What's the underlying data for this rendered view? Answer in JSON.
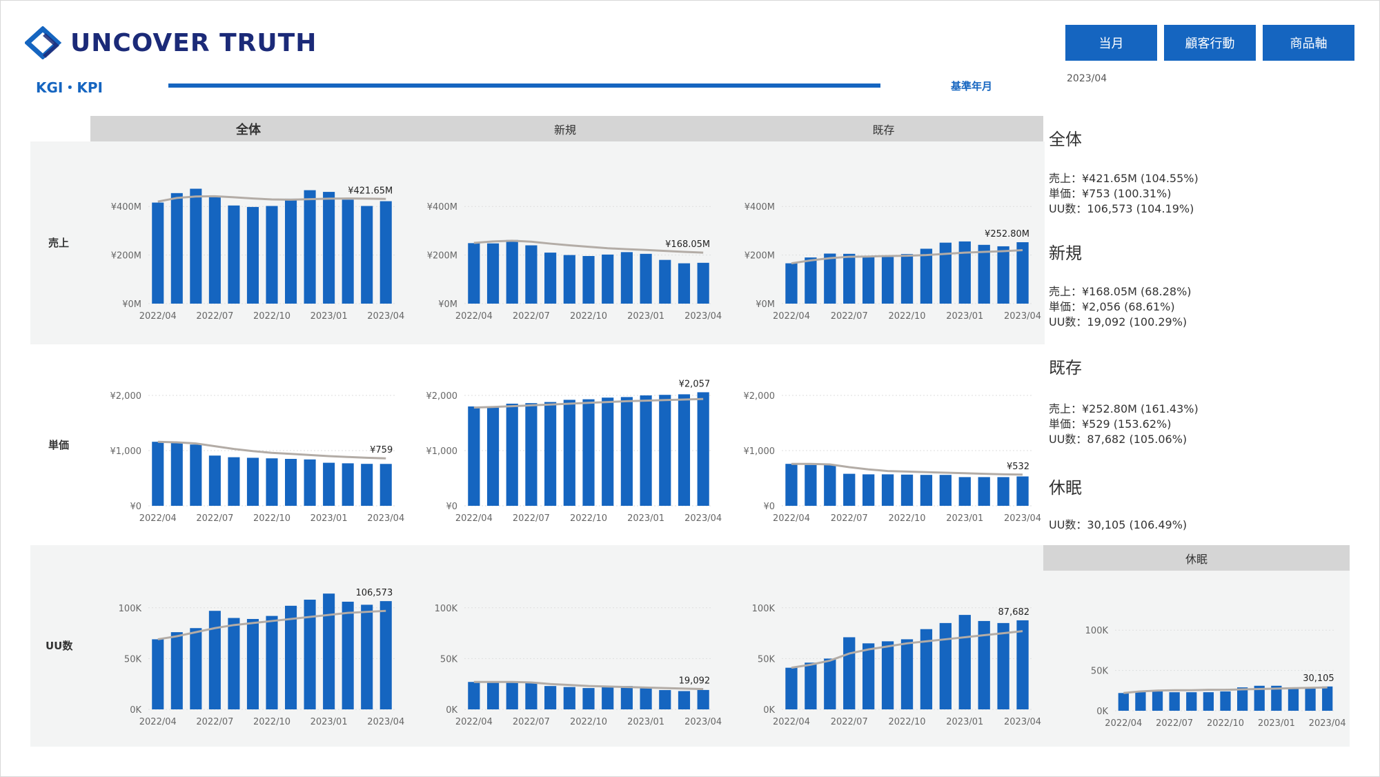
{
  "brand": {
    "name": "UNCOVER TRUTH"
  },
  "page": {
    "title": "KGI・KPI",
    "base_label": "基準年月",
    "base_value": "2023/04"
  },
  "nav": [
    {
      "label": "当月"
    },
    {
      "label": "顧客行動"
    },
    {
      "label": "商品軸"
    }
  ],
  "columns": [
    {
      "label": "全体"
    },
    {
      "label": "新規"
    },
    {
      "label": "既存"
    }
  ],
  "rows": [
    {
      "label": "売上"
    },
    {
      "label": "単価"
    },
    {
      "label": "UU数"
    }
  ],
  "dormant": {
    "label": "休眠"
  },
  "summary": [
    {
      "title": "全体",
      "lines": [
        "売上：¥421.65M (104.55%)",
        "単価：¥753 (100.31%)",
        "UU数：106,573 (104.19%)"
      ]
    },
    {
      "title": "新規",
      "lines": [
        "売上：¥168.05M (68.28%)",
        "単価：¥2,056 (68.61%)",
        "UU数：19,092 (100.29%)"
      ]
    },
    {
      "title": "既存",
      "lines": [
        "売上：¥252.80M (161.43%)",
        "単価：¥529 (153.62%)",
        "UU数：87,682 (105.06%)"
      ]
    },
    {
      "title": "休眠",
      "lines": [
        "UU数：30,105 (106.49%)"
      ]
    }
  ],
  "colors": {
    "bar": "#1565c0",
    "trend": "#b3aca6",
    "band": "#f3f4f4",
    "header": "#d5d5d5"
  },
  "chart_data": [
    {
      "id": "sales-total",
      "type": "bar",
      "x": [
        "2022/04",
        "2022/05",
        "2022/06",
        "2022/07",
        "2022/08",
        "2022/09",
        "2022/10",
        "2022/11",
        "2022/12",
        "2023/01",
        "2023/02",
        "2023/03",
        "2023/04"
      ],
      "xticks": [
        "2022/04",
        "2022/07",
        "2022/10",
        "2023/01",
        "2023/04"
      ],
      "values": [
        416,
        455,
        473,
        444,
        404,
        398,
        402,
        432,
        467,
        460,
        428,
        402,
        421.65
      ],
      "trend": [
        420,
        435,
        441,
        442,
        438,
        433,
        429,
        428,
        430,
        432,
        433,
        432,
        431
      ],
      "yticks": [
        "¥0M",
        "¥200M",
        "¥400M"
      ],
      "ytick_values": [
        0,
        200,
        400
      ],
      "ylim": [
        0,
        500
      ],
      "end_label": "¥421.65M"
    },
    {
      "id": "sales-new",
      "type": "bar",
      "x": [
        "2022/04",
        "2022/05",
        "2022/06",
        "2022/07",
        "2022/08",
        "2022/09",
        "2022/10",
        "2022/11",
        "2022/12",
        "2023/01",
        "2023/02",
        "2023/03",
        "2023/04"
      ],
      "xticks": [
        "2022/04",
        "2022/07",
        "2022/10",
        "2023/01",
        "2023/04"
      ],
      "values": [
        249,
        248,
        262,
        240,
        210,
        200,
        196,
        202,
        212,
        205,
        180,
        166,
        168.05
      ],
      "trend": [
        250,
        256,
        259,
        255,
        247,
        240,
        234,
        228,
        224,
        221,
        217,
        213,
        210
      ],
      "yticks": [
        "¥0M",
        "¥200M",
        "¥400M"
      ],
      "ytick_values": [
        0,
        200,
        400
      ],
      "ylim": [
        0,
        500
      ],
      "end_label": "¥168.05M"
    },
    {
      "id": "sales-existing",
      "type": "bar",
      "x": [
        "2022/04",
        "2022/05",
        "2022/06",
        "2022/07",
        "2022/08",
        "2022/09",
        "2022/10",
        "2022/11",
        "2022/12",
        "2023/01",
        "2023/02",
        "2023/03",
        "2023/04"
      ],
      "xticks": [
        "2022/04",
        "2022/07",
        "2022/10",
        "2023/01",
        "2023/04"
      ],
      "values": [
        166,
        190,
        206,
        205,
        193,
        192,
        204,
        226,
        251,
        256,
        242,
        236,
        252.8
      ],
      "trend": [
        166,
        178,
        187,
        193,
        194,
        196,
        197,
        200,
        205,
        210,
        213,
        216,
        220
      ],
      "yticks": [
        "¥0M",
        "¥200M",
        "¥400M"
      ],
      "ytick_values": [
        0,
        200,
        400
      ],
      "ylim": [
        0,
        500
      ],
      "end_label": "¥252.80M"
    },
    {
      "id": "price-total",
      "type": "bar",
      "x": [
        "2022/04",
        "2022/05",
        "2022/06",
        "2022/07",
        "2022/08",
        "2022/09",
        "2022/10",
        "2022/11",
        "2022/12",
        "2023/01",
        "2023/02",
        "2023/03",
        "2023/04"
      ],
      "xticks": [
        "2022/04",
        "2022/07",
        "2022/10",
        "2023/01",
        "2023/04"
      ],
      "values": [
        1160,
        1140,
        1110,
        910,
        880,
        870,
        860,
        850,
        840,
        780,
        770,
        760,
        759
      ],
      "trend": [
        1160,
        1150,
        1130,
        1080,
        1030,
        990,
        960,
        940,
        920,
        900,
        885,
        870,
        860
      ],
      "yticks": [
        "¥0",
        "¥1,000",
        "¥2,000"
      ],
      "ytick_values": [
        0,
        1000,
        2000
      ],
      "ylim": [
        0,
        2200
      ],
      "end_label": "¥759"
    },
    {
      "id": "price-new",
      "type": "bar",
      "x": [
        "2022/04",
        "2022/05",
        "2022/06",
        "2022/07",
        "2022/08",
        "2022/09",
        "2022/10",
        "2022/11",
        "2022/12",
        "2023/01",
        "2023/02",
        "2023/03",
        "2023/04"
      ],
      "xticks": [
        "2022/04",
        "2022/07",
        "2022/10",
        "2023/01",
        "2023/04"
      ],
      "values": [
        1800,
        1800,
        1850,
        1860,
        1880,
        1920,
        1930,
        1960,
        1970,
        2000,
        2010,
        2020,
        2057
      ],
      "trend": [
        1780,
        1790,
        1805,
        1820,
        1835,
        1850,
        1865,
        1880,
        1895,
        1905,
        1915,
        1925,
        1935
      ],
      "yticks": [
        "¥0",
        "¥1,000",
        "¥2,000"
      ],
      "ytick_values": [
        0,
        1000,
        2000
      ],
      "ylim": [
        0,
        2200
      ],
      "end_label": "¥2,057"
    },
    {
      "id": "price-existing",
      "type": "bar",
      "x": [
        "2022/04",
        "2022/05",
        "2022/06",
        "2022/07",
        "2022/08",
        "2022/09",
        "2022/10",
        "2022/11",
        "2022/12",
        "2023/01",
        "2023/02",
        "2023/03",
        "2023/04"
      ],
      "xticks": [
        "2022/04",
        "2022/07",
        "2022/10",
        "2023/01",
        "2023/04"
      ],
      "values": [
        760,
        740,
        740,
        580,
        570,
        570,
        565,
        560,
        560,
        520,
        520,
        520,
        532
      ],
      "trend": [
        760,
        760,
        750,
        700,
        660,
        630,
        620,
        610,
        600,
        590,
        580,
        570,
        565
      ],
      "yticks": [
        "¥0",
        "¥1,000",
        "¥2,000"
      ],
      "ytick_values": [
        0,
        1000,
        2000
      ],
      "ylim": [
        0,
        2200
      ],
      "end_label": "¥532"
    },
    {
      "id": "uu-total",
      "type": "bar",
      "x": [
        "2022/04",
        "2022/05",
        "2022/06",
        "2022/07",
        "2022/08",
        "2022/09",
        "2022/10",
        "2022/11",
        "2022/12",
        "2023/01",
        "2023/02",
        "2023/03",
        "2023/04"
      ],
      "xticks": [
        "2022/04",
        "2022/07",
        "2022/10",
        "2023/01",
        "2023/04"
      ],
      "values": [
        69000,
        76000,
        80000,
        97000,
        90000,
        89000,
        92000,
        102000,
        108000,
        114000,
        106000,
        103000,
        106573
      ],
      "trend": [
        69000,
        72000,
        76000,
        80000,
        83000,
        85000,
        87000,
        89000,
        91000,
        93000,
        95000,
        96000,
        97000
      ],
      "yticks": [
        "0K",
        "50K",
        "100K"
      ],
      "ytick_values": [
        0,
        50000,
        100000
      ],
      "ylim": [
        0,
        125000
      ],
      "end_label": "106,573"
    },
    {
      "id": "uu-new",
      "type": "bar",
      "x": [
        "2022/04",
        "2022/05",
        "2022/06",
        "2022/07",
        "2022/08",
        "2022/09",
        "2022/10",
        "2022/11",
        "2022/12",
        "2023/01",
        "2023/02",
        "2023/03",
        "2023/04"
      ],
      "xticks": [
        "2022/04",
        "2022/07",
        "2022/10",
        "2023/01",
        "2023/04"
      ],
      "values": [
        27000,
        27000,
        27000,
        26000,
        23000,
        22000,
        21000,
        22000,
        23000,
        22000,
        19000,
        18000,
        19092
      ],
      "trend": [
        27000,
        27000,
        27000,
        26500,
        25000,
        24000,
        23000,
        22500,
        22000,
        21500,
        21000,
        20500,
        20000
      ],
      "yticks": [
        "0K",
        "50K",
        "100K"
      ],
      "ytick_values": [
        0,
        50000,
        100000
      ],
      "ylim": [
        0,
        125000
      ],
      "end_label": "19,092"
    },
    {
      "id": "uu-existing",
      "type": "bar",
      "x": [
        "2022/04",
        "2022/05",
        "2022/06",
        "2022/07",
        "2022/08",
        "2022/09",
        "2022/10",
        "2022/11",
        "2022/12",
        "2023/01",
        "2023/02",
        "2023/03",
        "2023/04"
      ],
      "xticks": [
        "2022/04",
        "2022/07",
        "2022/10",
        "2023/01",
        "2023/04"
      ],
      "values": [
        41000,
        46000,
        50000,
        71000,
        65000,
        67000,
        69000,
        79000,
        85000,
        93000,
        87000,
        85000,
        87682
      ],
      "trend": [
        41000,
        44000,
        48000,
        55000,
        59000,
        62000,
        65000,
        67000,
        69000,
        71000,
        73000,
        75000,
        77000
      ],
      "yticks": [
        "0K",
        "50K",
        "100K"
      ],
      "ytick_values": [
        0,
        50000,
        100000
      ],
      "ylim": [
        0,
        125000
      ],
      "end_label": "87,682"
    },
    {
      "id": "uu-dormant",
      "type": "bar",
      "x": [
        "2022/04",
        "2022/05",
        "2022/06",
        "2022/07",
        "2022/08",
        "2022/09",
        "2022/10",
        "2022/11",
        "2022/12",
        "2023/01",
        "2023/02",
        "2023/03",
        "2023/04"
      ],
      "xticks": [
        "2022/04",
        "2022/07",
        "2022/10",
        "2023/01",
        "2023/04"
      ],
      "values": [
        22000,
        24000,
        25000,
        23000,
        23000,
        23000,
        24000,
        29000,
        31000,
        31000,
        29000,
        29000,
        30105
      ],
      "trend": [
        22000,
        24000,
        25000,
        25500,
        25500,
        26000,
        26000,
        26500,
        27000,
        27500,
        28000,
        28500,
        29000
      ],
      "yticks": [
        "0K",
        "50K",
        "100K"
      ],
      "ytick_values": [
        0,
        50000,
        100000
      ],
      "ylim": [
        0,
        125000
      ],
      "end_label": "30,105"
    }
  ]
}
